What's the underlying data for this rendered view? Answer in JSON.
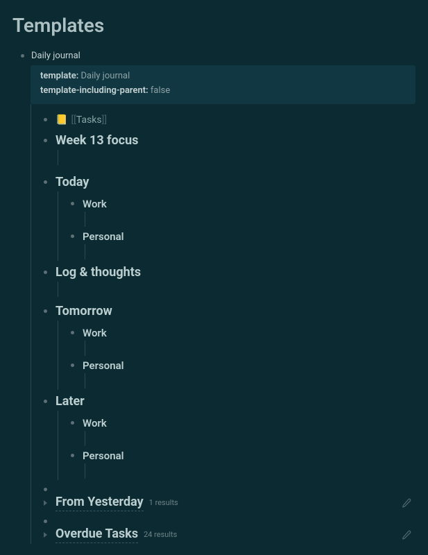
{
  "page": {
    "title": "Templates"
  },
  "root": {
    "label": "Daily journal",
    "props": [
      {
        "key": "template",
        "value": "Daily journal"
      },
      {
        "key": "template-including-parent",
        "value": "false"
      }
    ]
  },
  "tasksLink": {
    "emoji": "📒",
    "open": "[[",
    "text": "Tasks",
    "close": "]]"
  },
  "sections": {
    "week": {
      "title": "Week 13 focus"
    },
    "today": {
      "title": "Today",
      "items": [
        {
          "label": "Work"
        },
        {
          "label": "Personal"
        }
      ]
    },
    "log": {
      "title": "Log & thoughts"
    },
    "tomorrow": {
      "title": "Tomorrow",
      "items": [
        {
          "label": "Work"
        },
        {
          "label": "Personal"
        }
      ]
    },
    "later": {
      "title": "Later",
      "items": [
        {
          "label": "Work"
        },
        {
          "label": "Personal"
        }
      ]
    }
  },
  "queries": {
    "fromYesterday": {
      "title": "From Yesterday",
      "count": "1 results"
    },
    "overdue": {
      "title": "Overdue Tasks",
      "count": "24 results"
    }
  }
}
